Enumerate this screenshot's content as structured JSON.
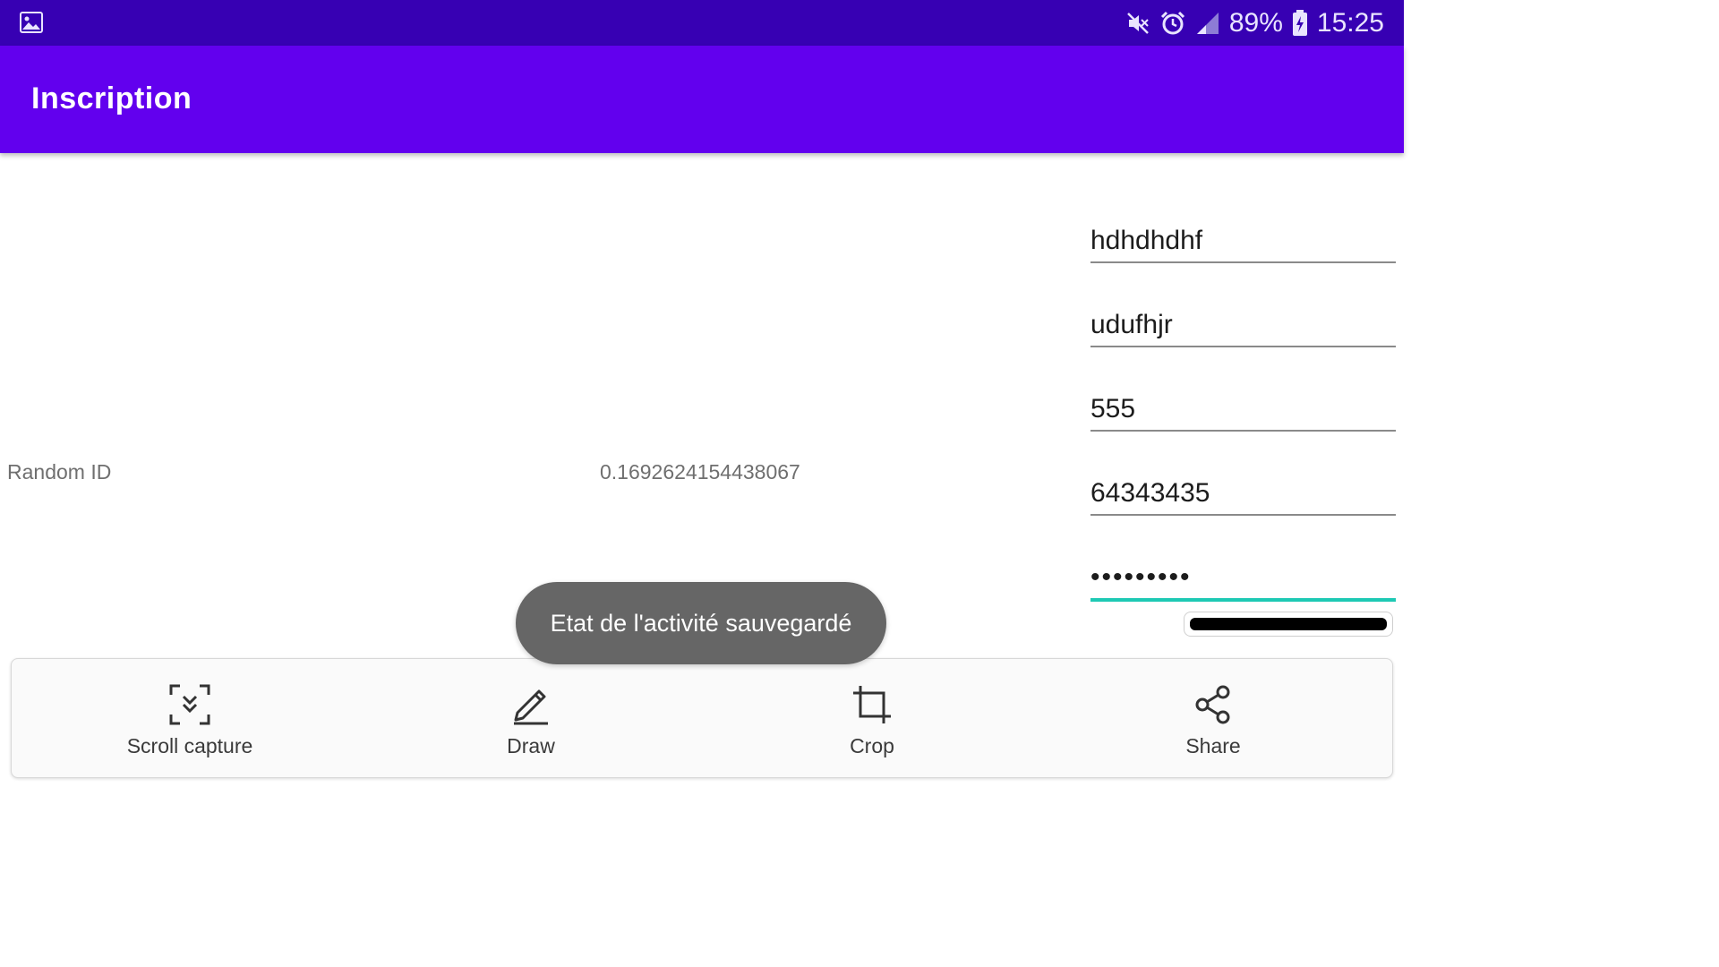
{
  "status_bar": {
    "battery": "89%",
    "time": "15:25",
    "icons": [
      "gallery-icon",
      "mute-icon",
      "alarm-icon",
      "signal-icon",
      "battery-charging-icon"
    ]
  },
  "app_bar": {
    "title": "Inscription"
  },
  "content": {
    "random_label": "Random ID",
    "random_value": "0.1692624154438067"
  },
  "form": {
    "fields": [
      {
        "value": "hdhdhdhf"
      },
      {
        "value": "udufhjr"
      },
      {
        "value": "555"
      },
      {
        "value": "64343435"
      },
      {
        "value": "•••••••••"
      }
    ],
    "accent_color": "#1ec9b4"
  },
  "toast": {
    "message": "Etat de l'activité sauvegardé"
  },
  "screenshot_toolbar": {
    "items": [
      {
        "label": "Scroll capture",
        "icon": "scroll-capture-icon"
      },
      {
        "label": "Draw",
        "icon": "pen-icon"
      },
      {
        "label": "Crop",
        "icon": "crop-icon"
      },
      {
        "label": "Share",
        "icon": "share-icon"
      }
    ]
  },
  "colors": {
    "status_bar": "#3700b3",
    "app_bar": "#6200ee"
  }
}
